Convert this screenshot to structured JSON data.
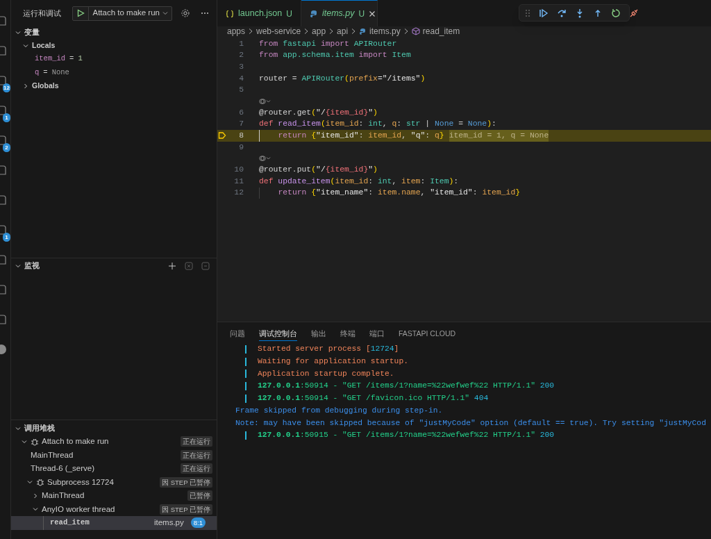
{
  "activity_bar": {
    "badges": [
      "12",
      "1",
      "2",
      "1"
    ]
  },
  "sidebar": {
    "title": "运行和调试",
    "launch_config": "Attach to make run",
    "variables": {
      "title": "变量",
      "expanded": true,
      "scopes": [
        {
          "name": "Locals",
          "expanded": true,
          "children": [
            {
              "name": "item_id",
              "operator": "=",
              "value": "1",
              "kind": "number"
            },
            {
              "name": "q",
              "operator": "=",
              "value": "None",
              "kind": "none"
            }
          ]
        },
        {
          "name": "Globals",
          "expanded": false
        }
      ]
    },
    "watch": {
      "title": "监视",
      "expanded": true
    },
    "call_stack": {
      "title": "调用堆栈",
      "expanded": true,
      "items": [
        {
          "kind": "session",
          "label": "Attach to make run",
          "expanded": true,
          "status": "正在运行",
          "children": [
            {
              "label": "MainThread",
              "status": "正在运行"
            },
            {
              "label": "Thread-6 (_serve)",
              "status": "正在运行"
            },
            {
              "kind": "session",
              "label": "Subprocess 12724",
              "expanded": true,
              "status": "因 STEP 已暂停",
              "children": [
                {
                  "label": "MainThread",
                  "expanded": false,
                  "status": "已暂停"
                },
                {
                  "label": "AnyIO worker thread",
                  "expanded": true,
                  "status": "因 STEP 已暂停",
                  "children": [
                    {
                      "kind": "frame",
                      "label": "read_item",
                      "file": "items.py",
                      "position": "8:1",
                      "selected": true
                    }
                  ]
                }
              ]
            }
          ]
        }
      ]
    }
  },
  "editor": {
    "tabs": [
      {
        "label": "launch.json",
        "status": "U",
        "kind": "json",
        "selected": false,
        "preview": false
      },
      {
        "label": "items.py",
        "status": "U",
        "kind": "python",
        "selected": true,
        "preview": true
      }
    ],
    "breadcrumb": [
      {
        "text": "apps",
        "kind": "folder"
      },
      {
        "text": "web-service",
        "kind": "folder"
      },
      {
        "text": "app",
        "kind": "folder"
      },
      {
        "text": "api",
        "kind": "folder"
      },
      {
        "text": "items.py",
        "kind": "file"
      },
      {
        "text": "read_item",
        "kind": "symbol"
      }
    ],
    "lines": [
      {
        "kind": "code",
        "number": "1",
        "current": false,
        "indented": false,
        "tokens": [
          {
            "text": "from ",
            "kind": "kw"
          },
          {
            "text": "fastapi ",
            "kind": "mod"
          },
          {
            "text": "import ",
            "kind": "kw"
          },
          {
            "text": "APIRouter",
            "kind": "mod"
          }
        ]
      },
      {
        "kind": "code",
        "number": "2",
        "current": false,
        "indented": false,
        "tokens": [
          {
            "text": "from ",
            "kind": "kw"
          },
          {
            "text": "app.schema.item ",
            "kind": "mod"
          },
          {
            "text": "import ",
            "kind": "kw"
          },
          {
            "text": "Item",
            "kind": "mod"
          }
        ]
      },
      {
        "kind": "code",
        "number": "3",
        "current": false
      },
      {
        "kind": "code",
        "number": "4",
        "current": false,
        "indented": false,
        "tokens": [
          {
            "text": "router = ",
            "kind": "plain"
          },
          {
            "text": "APIRouter",
            "kind": "mod"
          },
          {
            "text": "(",
            "kind": "bracket"
          },
          {
            "text": "prefix",
            "kind": "param"
          },
          {
            "text": "=\"/items\"",
            "kind": "str"
          },
          {
            "text": ")",
            "kind": "bracket"
          }
        ]
      },
      {
        "kind": "code",
        "number": "5",
        "current": false
      },
      {
        "kind": "codelens"
      },
      {
        "kind": "code",
        "number": "6",
        "current": false,
        "indented": false,
        "tokens": [
          {
            "text": "@router.get",
            "kind": "plain"
          },
          {
            "text": "(",
            "kind": "bracket"
          },
          {
            "text": "\"/",
            "kind": "str"
          },
          {
            "text": "{item_id}",
            "kind": "interp"
          },
          {
            "text": "\"",
            "kind": "str"
          },
          {
            "text": ")",
            "kind": "bracket"
          }
        ]
      },
      {
        "kind": "code",
        "number": "7",
        "current": false,
        "indented": false,
        "tokens": [
          {
            "text": "def ",
            "kind": "def"
          },
          {
            "text": "read_item",
            "kind": "fn"
          },
          {
            "text": "(",
            "kind": "bracket"
          },
          {
            "text": "item_id",
            "kind": "param"
          },
          {
            "text": ": ",
            "kind": "plain"
          },
          {
            "text": "int",
            "kind": "mod"
          },
          {
            "text": ", ",
            "kind": "plain"
          },
          {
            "text": "q",
            "kind": "param"
          },
          {
            "text": ": ",
            "kind": "plain"
          },
          {
            "text": "str",
            "kind": "mod"
          },
          {
            "text": " | ",
            "kind": "plain"
          },
          {
            "text": "None",
            "kind": "none"
          },
          {
            "text": " = ",
            "kind": "plain"
          },
          {
            "text": "None",
            "kind": "none"
          },
          {
            "text": ")",
            "kind": "bracket"
          },
          {
            "text": ":",
            "kind": "plain"
          }
        ]
      },
      {
        "kind": "code",
        "number": "8",
        "current": true,
        "indented": true,
        "inline_value": "item_id = 1, q = None",
        "tokens": [
          {
            "text": "return ",
            "kind": "kw"
          },
          {
            "text": "{",
            "kind": "bracket"
          },
          {
            "text": "\"item_id\"",
            "kind": "str"
          },
          {
            "text": ": ",
            "kind": "plain"
          },
          {
            "text": "item_id",
            "kind": "param"
          },
          {
            "text": ", ",
            "kind": "plain"
          },
          {
            "text": "\"q\"",
            "kind": "str"
          },
          {
            "text": ": ",
            "kind": "plain"
          },
          {
            "text": "q",
            "kind": "param"
          },
          {
            "text": "}",
            "kind": "bracket"
          }
        ]
      },
      {
        "kind": "code",
        "number": "9",
        "current": false
      },
      {
        "kind": "codelens"
      },
      {
        "kind": "code",
        "number": "10",
        "current": false,
        "indented": false,
        "tokens": [
          {
            "text": "@router.put",
            "kind": "plain"
          },
          {
            "text": "(",
            "kind": "bracket"
          },
          {
            "text": "\"/",
            "kind": "str"
          },
          {
            "text": "{item_id}",
            "kind": "interp"
          },
          {
            "text": "\"",
            "kind": "str"
          },
          {
            "text": ")",
            "kind": "bracket"
          }
        ]
      },
      {
        "kind": "code",
        "number": "11",
        "current": false,
        "indented": false,
        "tokens": [
          {
            "text": "def ",
            "kind": "def"
          },
          {
            "text": "update_item",
            "kind": "fn"
          },
          {
            "text": "(",
            "kind": "bracket"
          },
          {
            "text": "item_id",
            "kind": "param"
          },
          {
            "text": ": ",
            "kind": "plain"
          },
          {
            "text": "int",
            "kind": "mod"
          },
          {
            "text": ", ",
            "kind": "plain"
          },
          {
            "text": "item",
            "kind": "param"
          },
          {
            "text": ": ",
            "kind": "plain"
          },
          {
            "text": "Item",
            "kind": "mod"
          },
          {
            "text": ")",
            "kind": "bracket"
          },
          {
            "text": ":",
            "kind": "plain"
          }
        ]
      },
      {
        "kind": "code",
        "number": "12",
        "current": false,
        "indented": true,
        "tokens": [
          {
            "text": "return ",
            "kind": "kw"
          },
          {
            "text": "{",
            "kind": "bracket"
          },
          {
            "text": "\"item_name\"",
            "kind": "str"
          },
          {
            "text": ": ",
            "kind": "plain"
          },
          {
            "text": "item.name",
            "kind": "param"
          },
          {
            "text": ", ",
            "kind": "plain"
          },
          {
            "text": "\"item_id\"",
            "kind": "str"
          },
          {
            "text": ": ",
            "kind": "plain"
          },
          {
            "text": "item_id",
            "kind": "param"
          },
          {
            "text": "}",
            "kind": "bracket"
          }
        ]
      }
    ]
  },
  "panel": {
    "tabs": [
      {
        "label": "问题",
        "selected": false
      },
      {
        "label": "调试控制台",
        "selected": true
      },
      {
        "label": "输出",
        "selected": false
      },
      {
        "label": "终端",
        "selected": false
      },
      {
        "label": "端口",
        "selected": false
      },
      {
        "label": "FASTAPI CLOUD",
        "selected": false
      }
    ],
    "lines": [
      {
        "indented": true,
        "segments": [
          {
            "text": "Started server process [",
            "kind": "warn"
          },
          {
            "text": "12724",
            "kind": "num"
          },
          {
            "text": "]",
            "kind": "warn"
          }
        ]
      },
      {
        "indented": true,
        "segments": [
          {
            "text": "Waiting for application startup.",
            "kind": "warn"
          }
        ]
      },
      {
        "indented": true,
        "segments": [
          {
            "text": "Application startup complete.",
            "kind": "warn"
          }
        ]
      },
      {
        "indented": true,
        "segments": [
          {
            "text": "127.0.0.1",
            "kind": "ok_bold"
          },
          {
            "text": ":50914 - \"GET /items/1?name=%22wefwef%22 HTTP/1.1\" ",
            "kind": "ok"
          },
          {
            "text": "200",
            "kind": "num"
          }
        ]
      },
      {
        "indented": true,
        "segments": [
          {
            "text": "127.0.0.1",
            "kind": "ok_bold"
          },
          {
            "text": ":50914 - \"GET /favicon.ico HTTP/1.1\" ",
            "kind": "ok"
          },
          {
            "text": "404",
            "kind": "num"
          }
        ]
      },
      {
        "indented": false,
        "segments": [
          {
            "text": "Frame skipped from debugging during step-in.",
            "kind": "info"
          }
        ]
      },
      {
        "indented": false,
        "segments": [
          {
            "text": "Note: may have been skipped because of \"justMyCode\" option (default == true). Try setting \"justMyCod",
            "kind": "info"
          }
        ]
      },
      {
        "indented": true,
        "segments": [
          {
            "text": "127.0.0.1",
            "kind": "ok_bold"
          },
          {
            "text": ":50915 - \"GET /items/1?name=%22wefwef%22 HTTP/1.1\" ",
            "kind": "ok"
          },
          {
            "text": "200",
            "kind": "num"
          }
        ]
      }
    ]
  }
}
